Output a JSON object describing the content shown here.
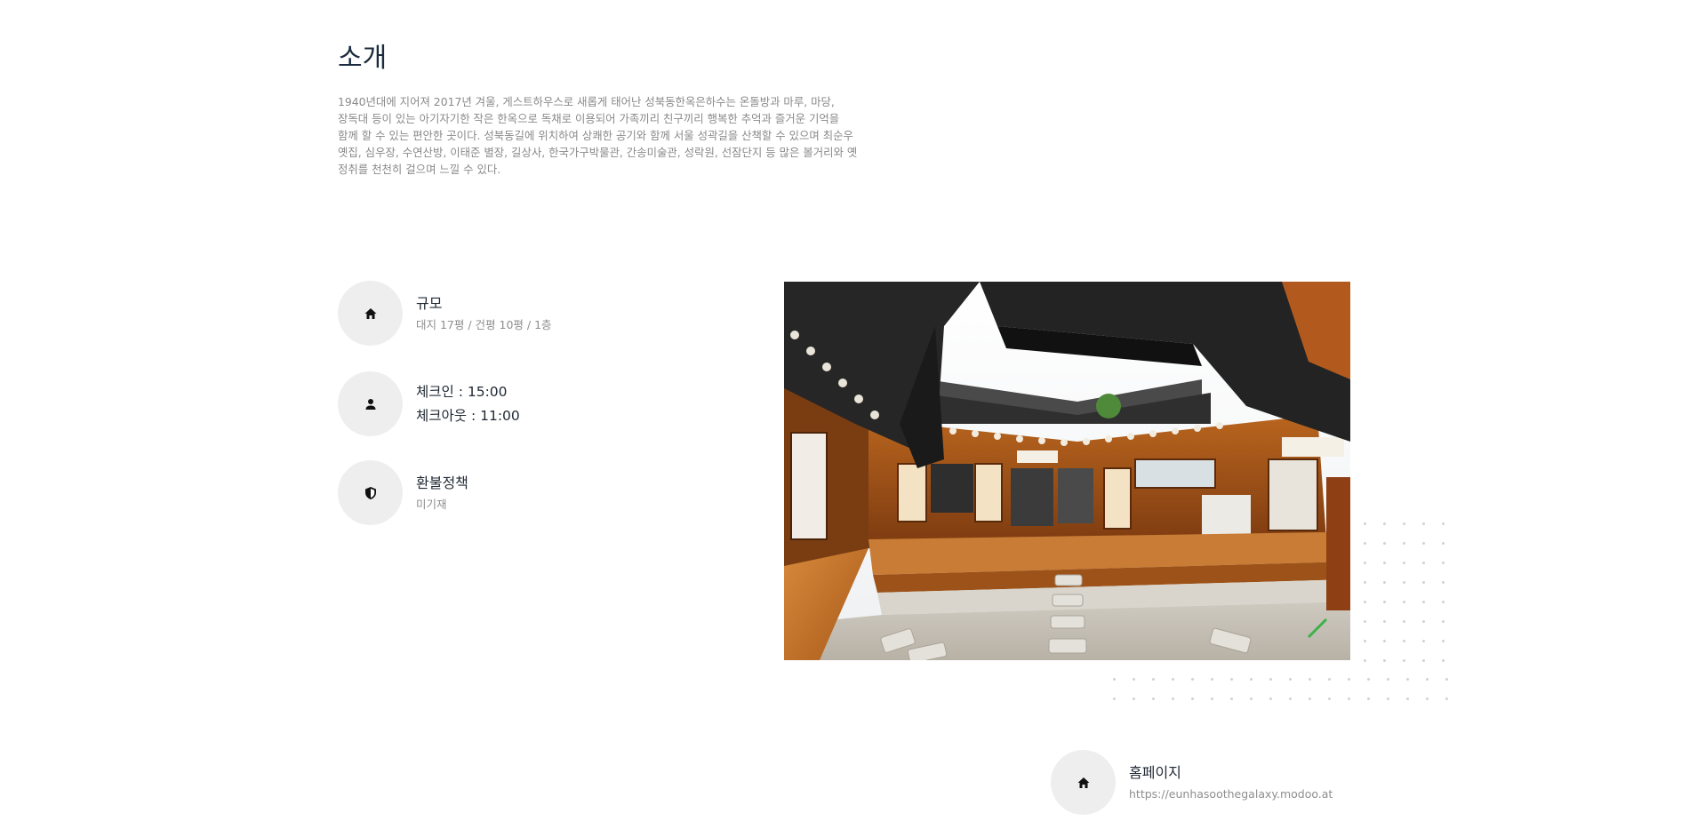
{
  "intro": {
    "title": "소개",
    "body": "1940년대에 지어져 2017년 겨울, 게스트하우스로 새롭게 태어난 성북동한옥은하수는 온돌방과 마루, 마당, 장독대 등이 있는 아기자기한 작은 한옥으로 독채로 이용되어 가족끼리 친구끼리 행복한 추억과 즐거운 기억을 함께 할 수 있는 편안한 곳이다. 성북동길에 위치하여 상쾌한 공기와 함께 서울 성곽길을 산책할 수 있으며 최순우 옛집, 심우장, 수연산방, 이태준 별장, 길상사, 한국가구박물관, 간송미술관, 성락원, 선잠단지 등 많은 볼거리와 옛 정취를 천천히 걸으며 느낄 수 있다."
  },
  "features": {
    "size": {
      "icon": "home-icon",
      "label": "규모",
      "value": "대지 17평 / 건평 10평 / 1층"
    },
    "checkin": {
      "icon": "person-icon",
      "checkin": "체크인 : 15:00",
      "checkout": "체크아웃 : 11:00"
    },
    "refund": {
      "icon": "shield-icon",
      "label": "환불정책",
      "value": "미기재"
    },
    "homepage": {
      "icon": "home-icon",
      "label": "홈페이지",
      "value": "https://eunhasoothegalaxy.modoo.at"
    }
  },
  "colors": {
    "icon_circle_bg": "#eeeeee",
    "title": "#1b2a3d",
    "muted_text": "#8a8a8a",
    "dot_pattern": "#cfd2d6"
  }
}
